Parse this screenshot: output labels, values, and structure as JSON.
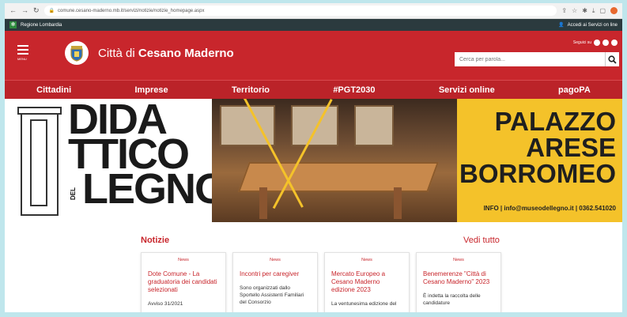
{
  "browser": {
    "url": "comune.cesano-maderno.mb.it/servizi/notizie/notizie_homepage.aspx"
  },
  "region_bar": {
    "label": "Regione Lombardia",
    "access_label": "Accedi ai Servizi on line"
  },
  "header": {
    "menu_label": "MENU",
    "title_prefix": "Città di",
    "title_name": "Cesano Maderno",
    "social_label": "Seguici su",
    "search_placeholder": "Cerca per parola..."
  },
  "nav": {
    "items": [
      "Cittadini",
      "Imprese",
      "Territorio",
      "#PGT2030",
      "Servizi online",
      "pagoPA"
    ]
  },
  "banner": {
    "left_line1": "DIDA",
    "left_line2": "TTICO",
    "left_line3": "LEGNO",
    "left_small": "DEL",
    "right_line1": "PALAZZO",
    "right_line2": "ARESE",
    "right_line3": "BORROMEO",
    "info": "INFO | info@museodellegno.it | 0362.541020"
  },
  "news": {
    "title": "Notizie",
    "see_all": "Vedi tutto",
    "cards": [
      {
        "tag": "News",
        "title": "Dote Comune - La graduatoria dei candidati selezionati",
        "text": "Avviso 31/2021"
      },
      {
        "tag": "News",
        "title": "Incontri per caregiver",
        "text": "Sono organizzati dallo Sportello Assistenti Familiari del Consorzio"
      },
      {
        "tag": "News",
        "title": "Mercato Europeo a Cesano Maderno edizione 2023",
        "text": "La ventunesima edizione del"
      },
      {
        "tag": "News",
        "title": "Benemerenze \"Città di Cesano Maderno\" 2023",
        "text": "È indetta la raccolta delle candidature"
      }
    ]
  },
  "colors": {
    "brand_red": "#c8262c",
    "banner_yellow": "#f4c22a"
  }
}
